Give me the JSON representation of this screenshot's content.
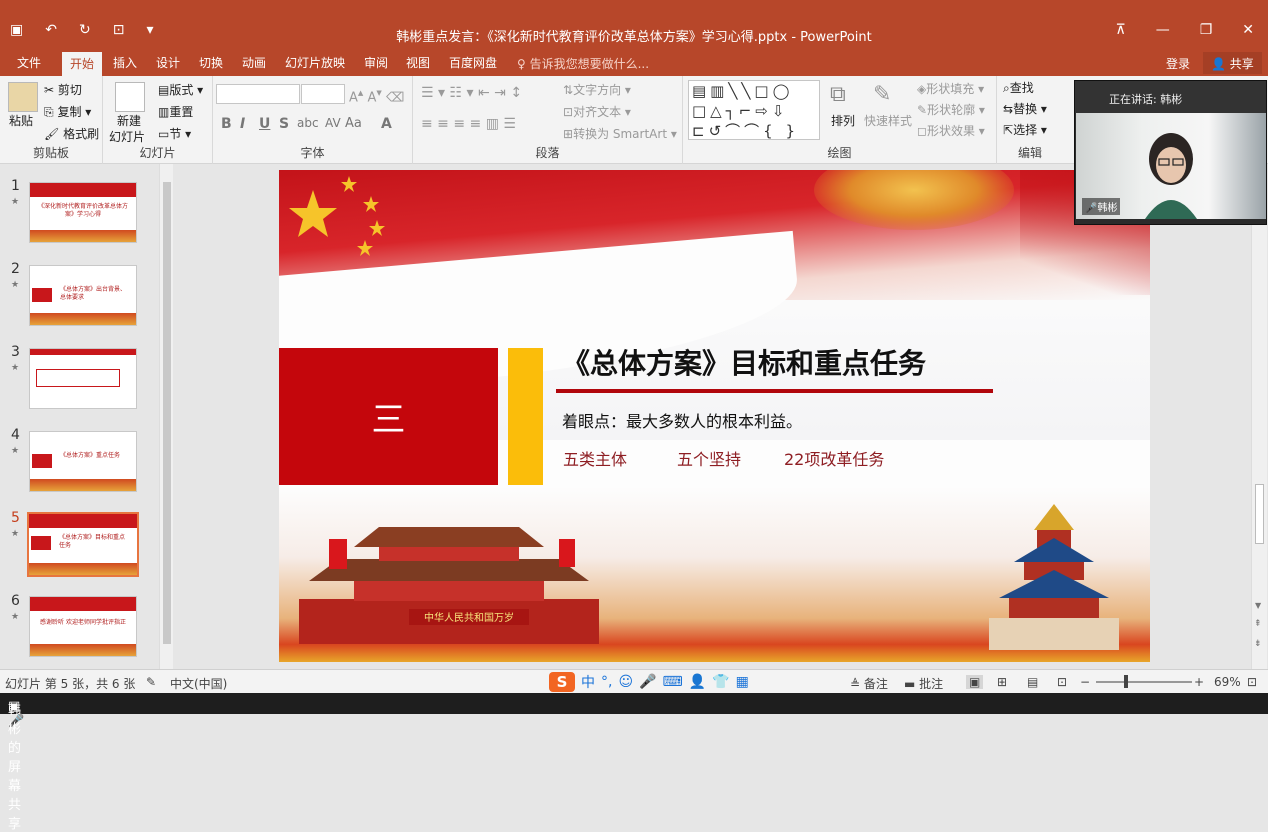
{
  "window": {
    "title": "韩彬重点发言：《深化新时代教育评价改革总体方案》学习心得.pptx - PowerPoint"
  },
  "tabs": {
    "file": "文件",
    "home": "开始",
    "insert": "插入",
    "design": "设计",
    "transitions": "切换",
    "animations": "动画",
    "slideshow": "幻灯片放映",
    "review": "审阅",
    "view": "视图",
    "baidu": "百度网盘",
    "tellme": "♀ 告诉我您想要做什么...",
    "login": "登录",
    "share": "共享"
  },
  "ribbon": {
    "clipboard": {
      "paste": "粘贴",
      "cut": "剪切",
      "copy": "复制",
      "format_painter": "格式刷",
      "label": "剪贴板"
    },
    "slides": {
      "new_slide_1": "新建",
      "new_slide_2": "幻灯片",
      "layout": "版式",
      "reset": "重置",
      "section": "节",
      "label": "幻灯片"
    },
    "font": {
      "label": "字体"
    },
    "paragraph": {
      "text_direction": "文字方向",
      "align_text": "对齐文本",
      "smartart": "转换为 SmartArt",
      "label": "段落"
    },
    "drawing": {
      "arrange": "排列",
      "quick_styles": "快速样式",
      "shape_fill": "形状填充",
      "shape_outline": "形状轮廓",
      "shape_effects": "形状效果",
      "label": "绘图"
    },
    "editing": {
      "find": "查找",
      "replace": "替换",
      "select": "选择",
      "label": "编辑"
    }
  },
  "thumbnails": [
    {
      "num": "1",
      "text": "《深化新时代教育评价改革总体方案》学习心得",
      "selected": false
    },
    {
      "num": "2",
      "text": "《总体方案》出台背景、总体要求",
      "selected": false
    },
    {
      "num": "3",
      "text": "",
      "selected": false
    },
    {
      "num": "4",
      "text": "《总体方案》重点任务",
      "selected": false
    },
    {
      "num": "5",
      "text": "《总体方案》目标和重点任务",
      "selected": true
    },
    {
      "num": "6",
      "text": "感谢聆听 欢迎老师同学批评指正",
      "selected": false
    }
  ],
  "slide": {
    "number_label": "三",
    "heading": "《总体方案》目标和重点任务",
    "subline": "着眼点：最大多数人的根本利益。",
    "keywords": [
      "五类主体",
      "五个坚持",
      "22项改革任务"
    ],
    "gate_sign": "中华人民共和国万岁"
  },
  "status": {
    "slide_info": "幻灯片 第 5 张，共 6 张",
    "language": "中文(中国)",
    "notes": "备注",
    "comments": "批注",
    "zoom": "69%",
    "ime_lang": "中"
  },
  "video": {
    "speaking": "正在讲话: 韩彬",
    "name": "韩彬"
  },
  "sharebar": {
    "label": "韩彬的屏幕共享"
  },
  "colors": {
    "accent": "#b7472a",
    "slide_red": "#c4060c",
    "slide_yellow": "#fbbd0a",
    "keyword": "#8e1e23"
  }
}
